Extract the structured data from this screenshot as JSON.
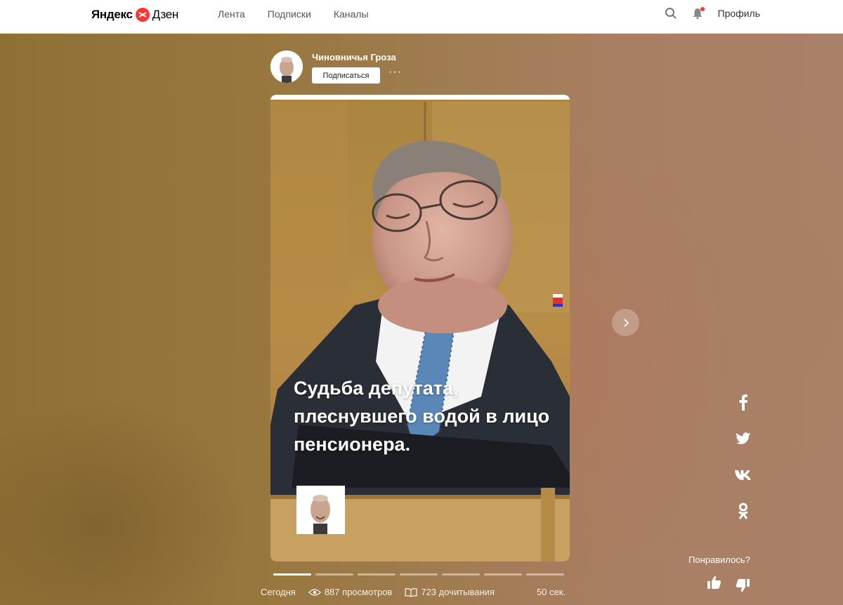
{
  "header": {
    "logo_yandex": "Яндекс",
    "logo_dzen": "Дзен",
    "nav": [
      "Лента",
      "Подписки",
      "Каналы"
    ],
    "profile_label": "Профиль"
  },
  "channel": {
    "name": "Чиновничья Гроза",
    "subscribe_label": "Подписаться",
    "more_label": "···"
  },
  "story": {
    "title": "Судьба депутата, плеснувшего водой в лицо пенсионера.",
    "progress": {
      "segments": 7,
      "active_index": 0
    }
  },
  "meta": {
    "date": "Сегодня",
    "views": "887 просмотров",
    "reads": "723 дочитывания",
    "duration": "50 сек."
  },
  "share": [
    "facebook-icon",
    "twitter-icon",
    "vk-icon",
    "odnoklassniki-icon"
  ],
  "feedback": {
    "label": "Понравилось?"
  },
  "colors": {
    "accent": "#ff3333",
    "header_bg": "#ffffff",
    "backdrop": "#98773e"
  }
}
